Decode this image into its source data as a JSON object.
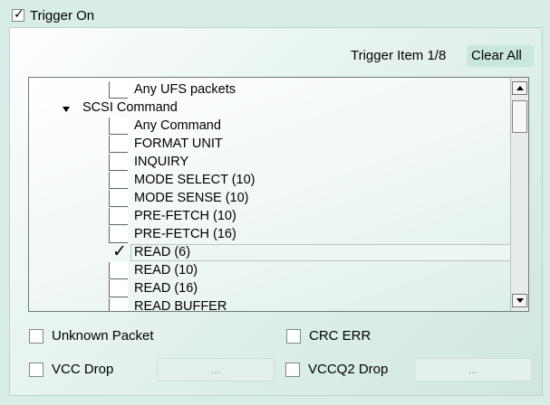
{
  "trigger_on": {
    "label": "Trigger On",
    "checked": true
  },
  "trigger_item": {
    "label": "Trigger Item 1/8",
    "clear_all": "Clear All"
  },
  "tree": {
    "items": [
      {
        "label": "Any UFS packets",
        "checked": false
      },
      {
        "label": "SCSI Command",
        "expanded": true
      },
      {
        "label": "Any Command",
        "checked": false
      },
      {
        "label": "FORMAT UNIT",
        "checked": false
      },
      {
        "label": "INQUIRY",
        "checked": false
      },
      {
        "label": "MODE SELECT (10)",
        "checked": false
      },
      {
        "label": "MODE SENSE (10)",
        "checked": false
      },
      {
        "label": "PRE-FETCH (10)",
        "checked": false
      },
      {
        "label": "PRE-FETCH (16)",
        "checked": false
      },
      {
        "label": "READ (6)",
        "checked": true
      },
      {
        "label": "READ (10)",
        "checked": false
      },
      {
        "label": "READ (16)",
        "checked": false
      },
      {
        "label": "READ BUFFER",
        "checked": false
      }
    ]
  },
  "options": {
    "unknown_packet": "Unknown Packet",
    "crc_err": "CRC ERR",
    "vcc_drop": "VCC Drop",
    "vcc_drop_button": "...",
    "vccq2_drop": "VCCQ2 Drop",
    "vccq2_drop_button": "..."
  }
}
